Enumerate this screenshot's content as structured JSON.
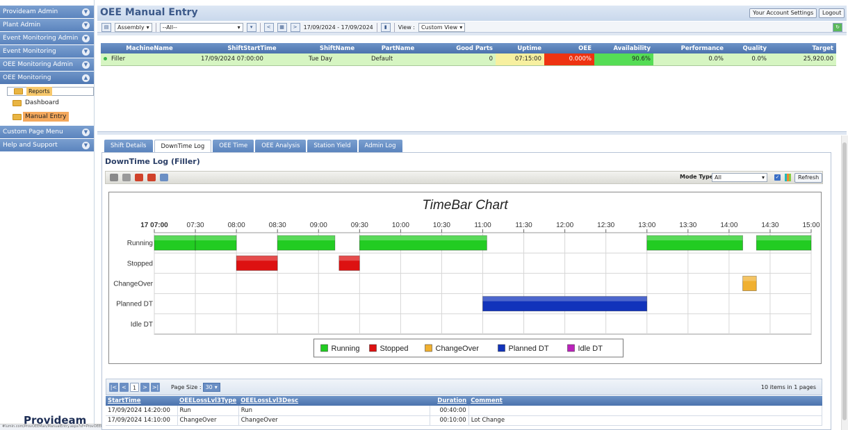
{
  "sidebar": {
    "items": [
      {
        "label": "Provideam Admin"
      },
      {
        "label": "Plant Admin"
      },
      {
        "label": "Event Monitoring Admin"
      },
      {
        "label": "Event Monitoring"
      },
      {
        "label": "OEE Monitoring Admin"
      },
      {
        "label": "OEE Monitoring"
      }
    ],
    "tree": [
      {
        "label": "Reports"
      },
      {
        "label": "Dashboard"
      },
      {
        "label": "Manual Entry"
      }
    ],
    "items_after": [
      {
        "label": "Custom Page Menu"
      },
      {
        "label": "Help and Support"
      }
    ],
    "brand": "Provideam",
    "status_url": "#lumin.com/ProvOEEMan/ManualEntry.aspx?sf=ProvOEEMan_ManualEntry#"
  },
  "header": {
    "title": "OEE Manual Entry",
    "account_settings": "Your Account Settings",
    "logout": "Logout"
  },
  "toolbar": {
    "assembly": "Assembly",
    "all": "--All--",
    "date_range": "17/09/2024 - 17/09/2024",
    "view_label": "View :",
    "view_value": "Custom View"
  },
  "shift_grid": {
    "columns": [
      "MachineName",
      "ShiftStartTime",
      "ShiftName",
      "PartName",
      "Good Parts",
      "Uptime",
      "OEE",
      "Availability",
      "Performance",
      "Quality",
      "Target"
    ],
    "row": {
      "machine": "Filler",
      "start": "17/09/2024 07:00:00",
      "shift": "Tue Day",
      "part": "Default",
      "good_parts": "0",
      "uptime": "07:15:00",
      "oee": "0.000%",
      "availability": "90.6%",
      "performance": "0.0%",
      "quality": "0.0%",
      "target": "25,920.00"
    }
  },
  "tabs": [
    "Shift Details",
    "DownTime Log",
    "OEE Time",
    "OEE Analysis",
    "Station Yield",
    "Admin Log"
  ],
  "panel": {
    "title": "DownTime Log (Filler)",
    "mode_type_label": "Mode Type",
    "mode_type_value": "All",
    "refresh": "Refresh"
  },
  "chart_data": {
    "type": "timebar",
    "title": "TimeBar Chart",
    "x_ticks": [
      "17 07:00",
      "07:30",
      "08:00",
      "08:30",
      "09:00",
      "09:30",
      "10:00",
      "10:30",
      "11:00",
      "11:30",
      "12:00",
      "12:30",
      "13:00",
      "13:30",
      "14:00",
      "14:30",
      "15:00"
    ],
    "xlim": [
      "07:00",
      "15:00"
    ],
    "categories": [
      "Running",
      "Stopped",
      "ChangeOver",
      "Planned DT",
      "Idle DT"
    ],
    "colors": {
      "Running": "#22cc22",
      "Stopped": "#dd1111",
      "ChangeOver": "#f0b030",
      "Planned DT": "#1133bb",
      "Idle DT": "#bb22bb"
    },
    "bars": [
      {
        "category": "Running",
        "start": "07:00",
        "end": "07:30"
      },
      {
        "category": "Running",
        "start": "07:30",
        "end": "08:00"
      },
      {
        "category": "Stopped",
        "start": "08:00",
        "end": "08:30"
      },
      {
        "category": "Running",
        "start": "08:30",
        "end": "09:12"
      },
      {
        "category": "Stopped",
        "start": "09:15",
        "end": "09:30"
      },
      {
        "category": "Running",
        "start": "09:30",
        "end": "11:03"
      },
      {
        "category": "Planned DT",
        "start": "11:00",
        "end": "13:00"
      },
      {
        "category": "Running",
        "start": "13:00",
        "end": "14:10"
      },
      {
        "category": "ChangeOver",
        "start": "14:10",
        "end": "14:20"
      },
      {
        "category": "Running",
        "start": "14:20",
        "end": "15:00"
      }
    ],
    "legend": [
      "Running",
      "Stopped",
      "ChangeOver",
      "Planned DT",
      "Idle DT"
    ],
    "legend_position": "bottom"
  },
  "pager": {
    "page": "1",
    "page_size_label": "Page Size :",
    "page_size": "30",
    "summary": "10 items in 1 pages"
  },
  "log_grid": {
    "columns": [
      "StartTime",
      "OEELossLvl3Type",
      "OEELossLvl3Desc",
      "Duration",
      "Comment"
    ],
    "rows": [
      {
        "start": "17/09/2024 14:20:00",
        "type": "Run",
        "desc": "Run",
        "duration": "00:40:00",
        "comment": ""
      },
      {
        "start": "17/09/2024 14:10:00",
        "type": "ChangeOver",
        "desc": "ChangeOver",
        "duration": "00:10:00",
        "comment": "Lot Change"
      }
    ]
  }
}
